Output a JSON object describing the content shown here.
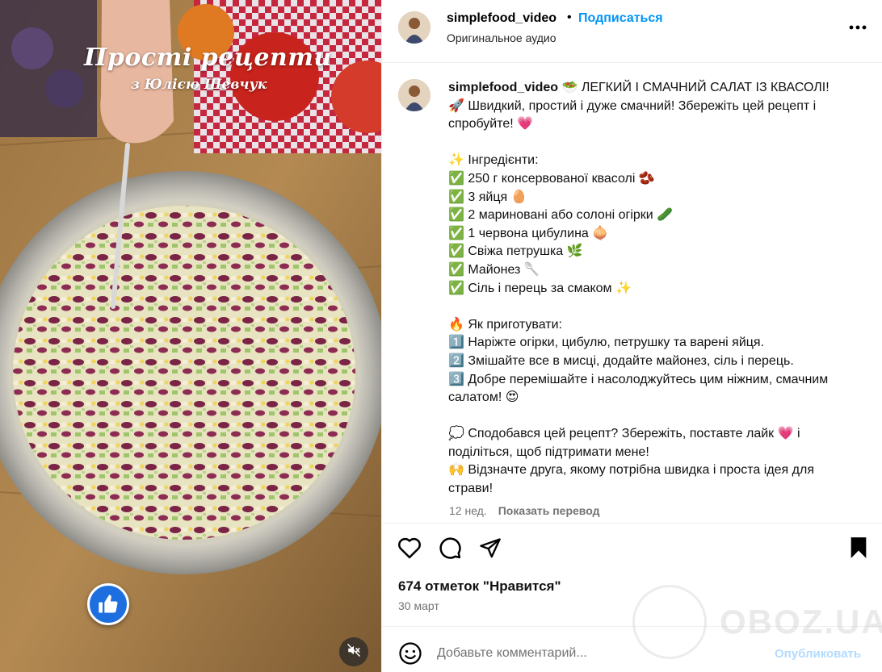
{
  "media": {
    "overlay_title": "Прості рецепти",
    "overlay_subtitle": "з Юлією Шевчук",
    "like_badge_icon": "thumbs-up-icon",
    "mute_icon": "speaker-muted-icon"
  },
  "header": {
    "username": "simplefood_video",
    "separator": "•",
    "follow_label": "Подписаться",
    "audio_label": "Оригинальное аудио",
    "more_icon": "more-horizontal-icon"
  },
  "caption": {
    "username": "simplefood_video",
    "text": " 🥗 ЛЕГКИЙ І СМАЧНИЙ САЛАТ ІЗ КВАСОЛІ!\n🚀 Швидкий, простий і дуже смачний! Збережіть цей рецепт і спробуйте! 💗\n\n✨ Інгредієнти:\n✅ 250 г консервованої квасолі 🫘\n✅ 3 яйця 🥚\n✅ 2 мариновані або солоні огірки 🥒\n✅ 1 червона цибулина 🧅\n✅ Свіжа петрушка 🌿\n✅ Майонез 🥄\n✅ Сіль і перець за смаком ✨\n\n🔥 Як приготувати:\n1️⃣ Наріжте огірки, цибулю, петрушку та варені яйця.\n2️⃣ Змішайте все в мисці, додайте майонез, сіль і перець.\n3️⃣ Добре перемішайте і насолоджуйтесь цим ніжним, смачним салатом! 😍\n\n💭 Сподобався цей рецепт? Збережіть, поставте лайк 💗 і поділіться, щоб підтримати мене!\n🙌 Відзначте друга, якому потрібна швидка і проста ідея для страви!",
    "age": "12 нед.",
    "translate_label": "Показать перевод"
  },
  "actions": {
    "like_icon": "heart-icon",
    "comment_icon": "comment-icon",
    "share_icon": "share-icon",
    "save_icon": "bookmark-icon",
    "likes_text": "674 отметок \"Нравится\"",
    "date": "30 март"
  },
  "comment": {
    "emoji_icon": "emoji-icon",
    "placeholder": "Добавьте комментарий...",
    "publish_label": "Опубликовать"
  },
  "watermark": {
    "text": "OBOZ.UA"
  },
  "colors": {
    "accent": "#0095f6",
    "publish_disabled": "#b3dbff",
    "muted_text": "#737373"
  }
}
